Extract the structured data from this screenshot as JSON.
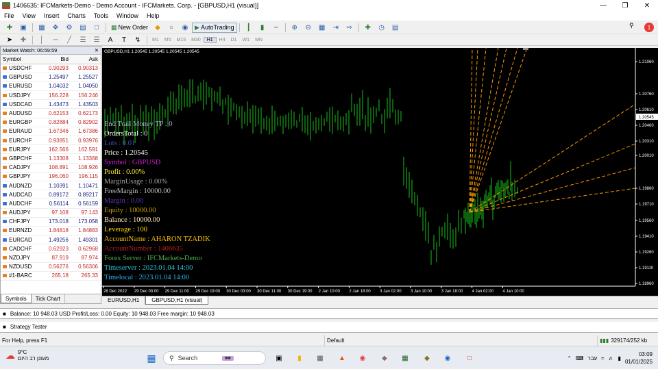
{
  "window": {
    "title": "1406635: IFCMarkets-Demo - Demo Account - IFCMarkets. Corp. - [GBPUSD,H1 (visual)]"
  },
  "menu": [
    "File",
    "View",
    "Insert",
    "Charts",
    "Tools",
    "Window",
    "Help"
  ],
  "toolbar": {
    "new_order": "New Order",
    "autotrading": "AutoTrading",
    "notification_count": "1"
  },
  "timeframes": [
    "M1",
    "M5",
    "M15",
    "M30",
    "H1",
    "H4",
    "D1",
    "W1",
    "MN"
  ],
  "active_timeframe": "H1",
  "market_watch": {
    "header": "Market Watch: 06:59:59",
    "columns": [
      "Symbol",
      "Bid",
      "Ask"
    ],
    "rows": [
      {
        "symbol": "USDCHF",
        "bid": "0.90293",
        "ask": "0.90313",
        "dir": "down"
      },
      {
        "symbol": "GBPUSD",
        "bid": "1.25497",
        "ask": "1.25527",
        "dir": "up"
      },
      {
        "symbol": "EURUSD",
        "bid": "1.04032",
        "ask": "1.04050",
        "dir": "up"
      },
      {
        "symbol": "USDJPY",
        "bid": "156.228",
        "ask": "156.246",
        "dir": "down"
      },
      {
        "symbol": "USDCAD",
        "bid": "1.43473",
        "ask": "1.43503",
        "dir": "up"
      },
      {
        "symbol": "AUDUSD",
        "bid": "0.62153",
        "ask": "0.62173",
        "dir": "down"
      },
      {
        "symbol": "EURGBP",
        "bid": "0.82884",
        "ask": "0.82902",
        "dir": "down"
      },
      {
        "symbol": "EURAUD",
        "bid": "1.67346",
        "ask": "1.67386",
        "dir": "down"
      },
      {
        "symbol": "EURCHF",
        "bid": "0.93951",
        "ask": "0.93976",
        "dir": "down"
      },
      {
        "symbol": "EURJPY",
        "bid": "162.566",
        "ask": "162.591",
        "dir": "down"
      },
      {
        "symbol": "GBPCHF",
        "bid": "1.13308",
        "ask": "1.13368",
        "dir": "down"
      },
      {
        "symbol": "CADJPY",
        "bid": "108.891",
        "ask": "108.926",
        "dir": "down"
      },
      {
        "symbol": "GBPJPY",
        "bid": "196.060",
        "ask": "196.115",
        "dir": "down"
      },
      {
        "symbol": "AUDNZD",
        "bid": "1.10391",
        "ask": "1.10471",
        "dir": "up"
      },
      {
        "symbol": "AUDCAD",
        "bid": "0.89172",
        "ask": "0.89217",
        "dir": "up"
      },
      {
        "symbol": "AUDCHF",
        "bid": "0.56114",
        "ask": "0.56159",
        "dir": "up"
      },
      {
        "symbol": "AUDJPY",
        "bid": "97.108",
        "ask": "97.143",
        "dir": "down"
      },
      {
        "symbol": "CHFJPY",
        "bid": "173.018",
        "ask": "173.058",
        "dir": "up"
      },
      {
        "symbol": "EURNZD",
        "bid": "1.84818",
        "ask": "1.84883",
        "dir": "down"
      },
      {
        "symbol": "EURCAD",
        "bid": "1.49256",
        "ask": "1.49301",
        "dir": "up"
      },
      {
        "symbol": "CADCHF",
        "bid": "0.62923",
        "ask": "0.62968",
        "dir": "down"
      },
      {
        "symbol": "NZDJPY",
        "bid": "87.919",
        "ask": "87.974",
        "dir": "down"
      },
      {
        "symbol": "NZDUSD",
        "bid": "0.56276",
        "ask": "0.56306",
        "dir": "down"
      },
      {
        "symbol": "#1-BARC",
        "bid": "265.18",
        "ask": "265.33",
        "dir": "down"
      }
    ],
    "tabs": [
      "Symbols",
      "Tick Chart"
    ]
  },
  "chart": {
    "info": "GBPUSD,H1  1.20545 1.20545 1.20545 1.20545",
    "price_labels": [
      "1.21060",
      "1.20760",
      "1.20610",
      "1.20460",
      "1.20310",
      "1.20010",
      "1.19860",
      "1.19710",
      "1.19560",
      "1.19410",
      "1.19260",
      "1.19110",
      "1.18960"
    ],
    "current_price": "1.20545",
    "time_labels": [
      "28 Dec 2022",
      "29 Dec 03:00",
      "29 Dec 11:00",
      "29 Dec 19:00",
      "30 Dec 03:00",
      "30 Dec 11:00",
      "30 Dec 19:00",
      "2 Jan 10:00",
      "2 Jan 18:00",
      "3 Jan 02:00",
      "3 Jan 10:00",
      "3 Jan 18:00",
      "4 Jan 02:00",
      "4 Jan 10:00"
    ],
    "overlay": [
      {
        "text": "End Trail Money TP  :  0",
        "color": "#b39ddb"
      },
      {
        "text": "OrdersTotal  :  0",
        "color": "#ffffff"
      },
      {
        "text": "Lots  :  0.01",
        "color": "#3f51b5"
      },
      {
        "text": "Price  :  1.20545",
        "color": "#ffffff"
      },
      {
        "text": "Symbol  :  GBPUSD",
        "color": "#d81bd8"
      },
      {
        "text": "Profit  :  0.00%",
        "color": "#ffeb3b"
      },
      {
        "text": "MarginUsage  :  0.00%",
        "color": "#9e9e9e"
      },
      {
        "text": "FreeMargin  :  10000.00",
        "color": "#bdbdbd"
      },
      {
        "text": "Margin  :  0.00",
        "color": "#5e35b1"
      },
      {
        "text": "Equity  :  10000.00",
        "color": "#c8a000"
      },
      {
        "text": "Balance  :  10000.00",
        "color": "#ffe0b2"
      },
      {
        "text": "Leverage  :  100",
        "color": "#ffd600"
      },
      {
        "text": "AccountName  :  AHARON TZADIK",
        "color": "#ffc107"
      },
      {
        "text": "AccountNumber  :  1406635",
        "color": "#b71c1c"
      },
      {
        "text": "Forex Server  :  IFCMarkets-Demo",
        "color": "#4caf50"
      },
      {
        "text": "Timeserver  :  2023.01.04 14:00",
        "color": "#26c6da"
      },
      {
        "text": "Timelocal  :  2023.01.04 14:00",
        "color": "#29b6f6"
      }
    ],
    "tabs": [
      "EURUSD,H1",
      "GBPUSD,H1 (visual)"
    ]
  },
  "terminal": {
    "summary": "Balance: 10 948.03 USD  Profit/Loss: 0.00  Equity: 10 948.03  Free margin: 10 948.03"
  },
  "strategy_tester": "Strategy Tester",
  "status": {
    "help": "For Help, press F1",
    "profile": "Default",
    "traffic": "329174/252 kb"
  },
  "taskbar": {
    "temperature": "9°C",
    "weather_text": "מעונן רב היום",
    "search_placeholder": "Search",
    "lang": "עבר",
    "time": "03:09",
    "date": "01/01/2025"
  }
}
